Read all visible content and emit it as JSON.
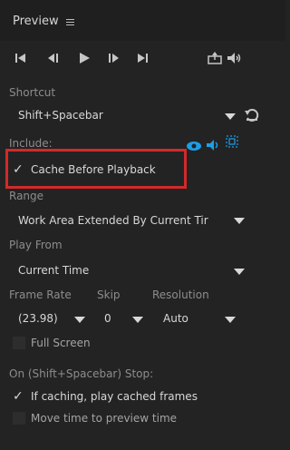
{
  "panel": {
    "title": "Preview"
  },
  "colors": {
    "background": "#232323",
    "topbar": "#1f1f1f",
    "accent_blue": "#1c9ee8",
    "highlight_red": "#d22a2a"
  },
  "transport": {
    "icons": [
      "go-to-start-icon",
      "step-back-icon",
      "play-icon",
      "step-forward-icon",
      "go-to-end-icon",
      "export-icon",
      "audio-icon"
    ]
  },
  "shortcut": {
    "label": "Shortcut",
    "value": "Shift+Spacebar",
    "reset_icon": "reset-icon"
  },
  "include": {
    "label": "Include:",
    "icons": [
      "video-eye-icon",
      "audio-speaker-icon",
      "overlay-grid-icon"
    ],
    "cache_checkbox": {
      "checked": true,
      "label": "Cache Before Playback"
    }
  },
  "range": {
    "label": "Range",
    "value": "Work Area Extended By Current Tir"
  },
  "play_from": {
    "label": "Play From",
    "value": "Current Time"
  },
  "frame_rate": {
    "label": "Frame Rate",
    "value": "(23.98)"
  },
  "skip": {
    "label": "Skip",
    "value": "0"
  },
  "resolution": {
    "label": "Resolution",
    "value": "Auto"
  },
  "full_screen": {
    "checked": false,
    "label": "Full Screen"
  },
  "stop_options": {
    "label": "On (Shift+Spacebar) Stop:",
    "if_caching": {
      "checked": true,
      "label": "If caching, play cached frames"
    },
    "move_time": {
      "checked": false,
      "label": "Move time to preview time"
    }
  }
}
